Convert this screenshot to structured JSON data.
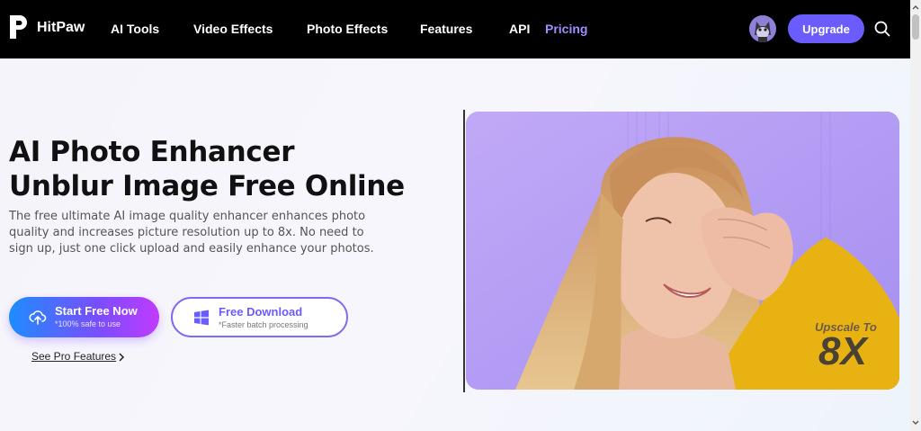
{
  "nav": {
    "brand": "HitPaw",
    "links": [
      "AI Tools",
      "Video Effects",
      "Photo Effects",
      "Features",
      "API",
      "Pricing"
    ],
    "active_link": "Pricing",
    "upgrade_label": "Upgrade"
  },
  "hero": {
    "title_line1": "AI Photo Enhancer",
    "title_line2": "Unblur Image Free Online",
    "description": "The free ultimate AI image quality enhancer enhances photo quality and increases picture resolution up to 8x. No need to sign up, just one click upload and easily enhance your photos.",
    "start_button": {
      "label": "Start Free Now",
      "sublabel": "*100% safe to use"
    },
    "download_button": {
      "label": "Free Download",
      "sublabel": "*Faster batch processing"
    },
    "pro_link": "See Pro Features",
    "upscale_label": "Upscale To",
    "upscale_value": "8X"
  },
  "colors": {
    "accent": "#6a5cff",
    "active_link": "#a48bff",
    "nav_bg": "#000000",
    "photo_bg": "#b59cf4"
  },
  "icons": [
    "hitpaw-logo-icon",
    "avatar",
    "search-icon",
    "upload-icon",
    "windows-icon",
    "chevron-right-icon"
  ]
}
